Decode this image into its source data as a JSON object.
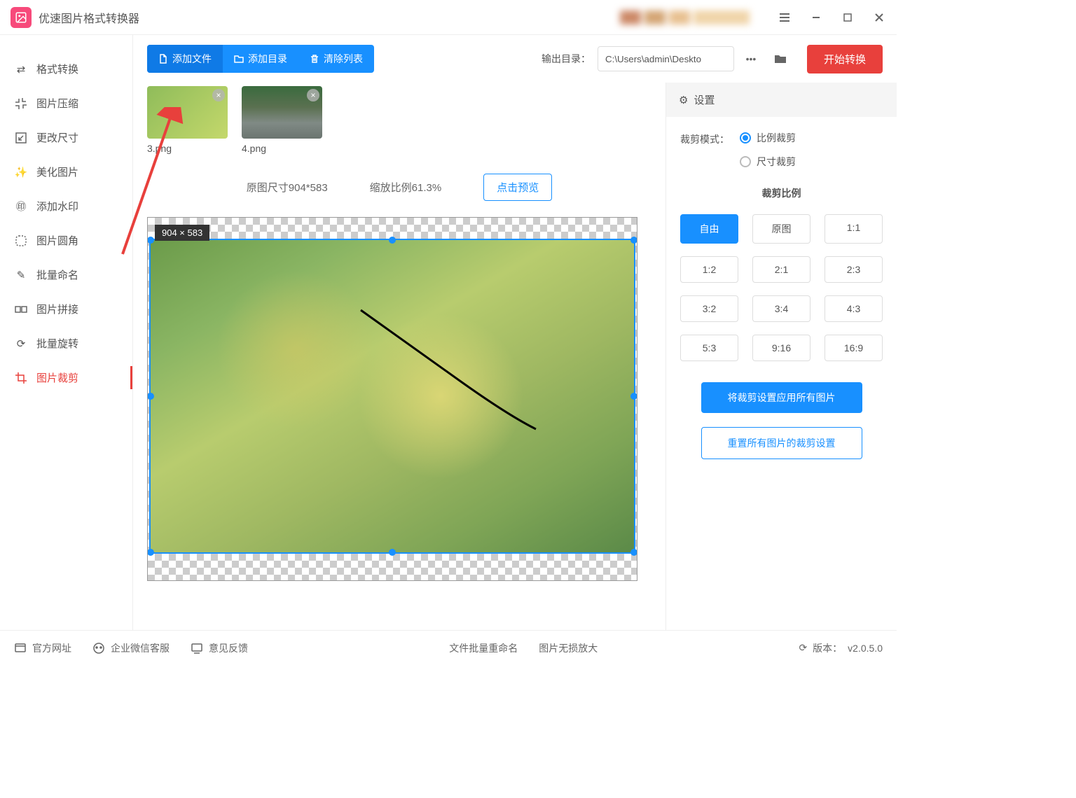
{
  "app": {
    "title": "优速图片格式转换器"
  },
  "titlebar_icons": {
    "menu": "menu-icon",
    "minimize": "minimize-icon",
    "maximize": "maximize-icon",
    "close": "close-icon"
  },
  "sidebar": {
    "items": [
      {
        "label": "格式转换",
        "icon": "convert-icon"
      },
      {
        "label": "图片压缩",
        "icon": "compress-icon"
      },
      {
        "label": "更改尺寸",
        "icon": "resize-icon"
      },
      {
        "label": "美化图片",
        "icon": "beautify-icon"
      },
      {
        "label": "添加水印",
        "icon": "watermark-icon"
      },
      {
        "label": "图片圆角",
        "icon": "rounded-icon"
      },
      {
        "label": "批量命名",
        "icon": "rename-icon"
      },
      {
        "label": "图片拼接",
        "icon": "stitch-icon"
      },
      {
        "label": "批量旋转",
        "icon": "rotate-icon"
      },
      {
        "label": "图片裁剪",
        "icon": "crop-icon"
      }
    ],
    "active_index": 9
  },
  "toolbar": {
    "add_file": "添加文件",
    "add_folder": "添加目录",
    "clear_list": "清除列表",
    "output_label": "输出目录：",
    "output_path": "C:\\Users\\admin\\Deskto",
    "start": "开始转换"
  },
  "thumbs": [
    {
      "name": "3.png"
    },
    {
      "name": "4.png"
    }
  ],
  "info": {
    "orig_size_label": "原图尺寸904*583",
    "zoom_label": "缩放比例61.3%",
    "preview_btn": "点击预览",
    "canvas_badge": "904 × 583"
  },
  "settings": {
    "header": "设置",
    "crop_mode_label": "裁剪模式：",
    "mode_ratio": "比例裁剪",
    "mode_size": "尺寸裁剪",
    "ratio_title": "裁剪比例",
    "ratios": [
      "自由",
      "原图",
      "1:1",
      "1:2",
      "2:1",
      "2:3",
      "3:2",
      "3:4",
      "4:3",
      "5:3",
      "9:16",
      "16:9"
    ],
    "active_ratio_index": 0,
    "apply_all": "将裁剪设置应用所有图片",
    "reset_all": "重置所有图片的裁剪设置"
  },
  "footer": {
    "website": "官方网址",
    "wechat": "企业微信客服",
    "feedback": "意见反馈",
    "batch_rename": "文件批量重命名",
    "lossless": "图片无损放大",
    "version_label": "版本：",
    "version": "v2.0.5.0"
  }
}
